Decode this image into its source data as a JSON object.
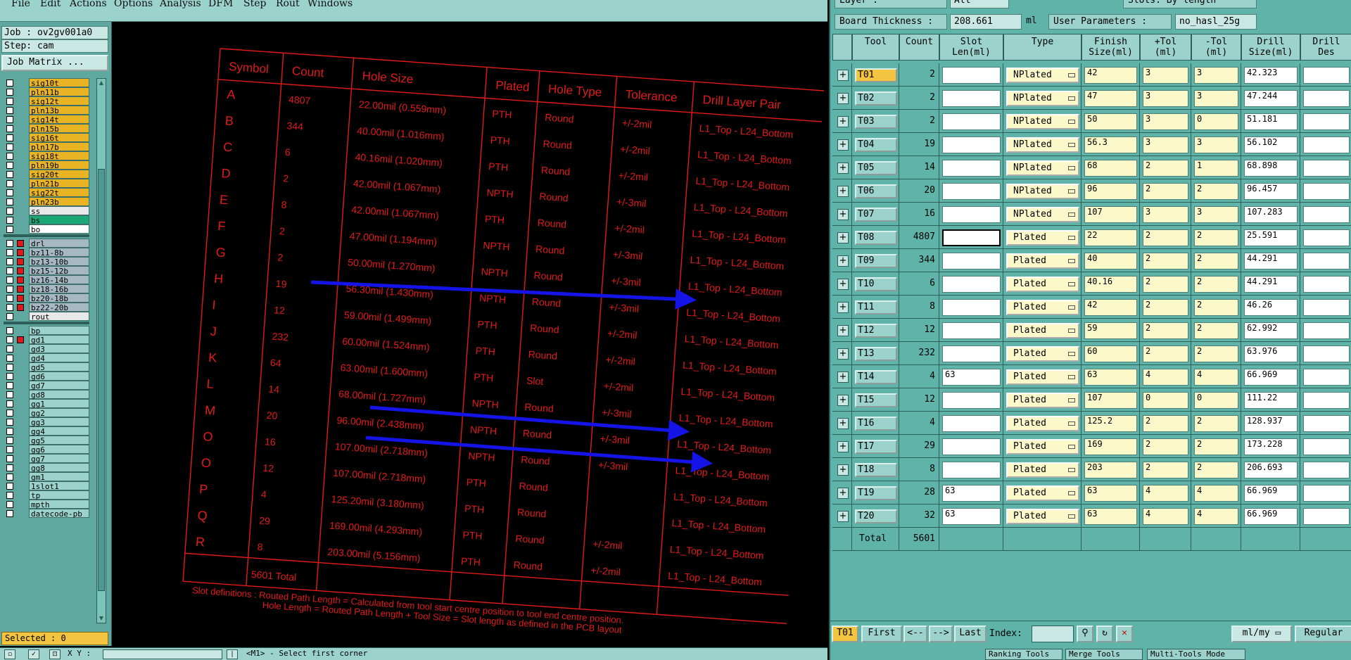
{
  "menu": [
    "File",
    "Edit",
    "Actions",
    "Options",
    "Analysis",
    "DFM",
    "Step",
    "Rout",
    "Windows"
  ],
  "job": {
    "job_label": "Job : ov2gv001a0",
    "step_label": "Step: cam",
    "matrix_button": "Job Matrix ...",
    "selected_label": "Selected : 0"
  },
  "layers_group1": [
    {
      "name": "sig10t",
      "color": "#e8b424",
      "mark": "↗"
    },
    {
      "name": "pln11b",
      "color": "#e8b424",
      "mark": ""
    },
    {
      "name": "sig12t",
      "color": "#e8b424",
      "mark": "↗"
    },
    {
      "name": "pln13b",
      "color": "#e8b424",
      "mark": ""
    },
    {
      "name": "sig14t",
      "color": "#e8b424",
      "mark": "↗"
    },
    {
      "name": "pln15b",
      "color": "#e8b424",
      "mark": ""
    },
    {
      "name": "sig16t",
      "color": "#e8b424",
      "mark": "↗"
    },
    {
      "name": "pln17b",
      "color": "#e8b424",
      "mark": ""
    },
    {
      "name": "sig18t",
      "color": "#e8b424",
      "mark": "↗"
    },
    {
      "name": "pln19b",
      "color": "#e8b424",
      "mark": ""
    },
    {
      "name": "sig20t",
      "color": "#e8b424",
      "mark": "↗"
    },
    {
      "name": "pln21b",
      "color": "#e8b424",
      "mark": ""
    },
    {
      "name": "sig22t",
      "color": "#e8b424",
      "mark": "↗"
    },
    {
      "name": "pln23b",
      "color": "#e8b424",
      "mark": ""
    },
    {
      "name": "ss",
      "color": "#e8e8e8",
      "mark": ""
    },
    {
      "name": "bs",
      "color": "#1aa877",
      "mark": ""
    },
    {
      "name": "bo",
      "color": "#ffffff",
      "mark": ""
    }
  ],
  "layers_group2": [
    {
      "name": "drl",
      "color": "#a6b9c3",
      "red": true
    },
    {
      "name": "bz11-8b",
      "color": "#a6b9c3",
      "red": true
    },
    {
      "name": "bz13-10b",
      "color": "#a6b9c3",
      "red": true
    },
    {
      "name": "bz15-12b",
      "color": "#a6b9c3",
      "red": true
    },
    {
      "name": "bz16-14b",
      "color": "#a6b9c3",
      "red": true
    },
    {
      "name": "bz18-16b",
      "color": "#a6b9c3",
      "red": true
    },
    {
      "name": "bz20-18b",
      "color": "#a6b9c3",
      "red": true
    },
    {
      "name": "bz22-20b",
      "color": "#a6b9c3",
      "red": true
    },
    {
      "name": "rout",
      "color": "#e8e8e8",
      "red": false
    }
  ],
  "layers_group3": [
    {
      "name": "bp",
      "color": "#9bd3cc",
      "mark": ""
    },
    {
      "name": "gd1",
      "color": "#9bd3cc",
      "mark": "≡"
    },
    {
      "name": "gd3",
      "color": "#9bd3cc",
      "mark": ""
    },
    {
      "name": "gd4",
      "color": "#9bd3cc",
      "mark": ""
    },
    {
      "name": "gd5",
      "color": "#9bd3cc",
      "mark": ""
    },
    {
      "name": "gd6",
      "color": "#9bd3cc",
      "mark": ""
    },
    {
      "name": "gd7",
      "color": "#9bd3cc",
      "mark": ""
    },
    {
      "name": "gd8",
      "color": "#9bd3cc",
      "mark": ""
    },
    {
      "name": "gg1",
      "color": "#9bd3cc",
      "mark": ""
    },
    {
      "name": "gg2",
      "color": "#9bd3cc",
      "mark": ""
    },
    {
      "name": "gg3",
      "color": "#9bd3cc",
      "mark": ""
    },
    {
      "name": "gg4",
      "color": "#9bd3cc",
      "mark": ""
    },
    {
      "name": "gg5",
      "color": "#9bd3cc",
      "mark": ""
    },
    {
      "name": "gg6",
      "color": "#9bd3cc",
      "mark": ""
    },
    {
      "name": "gg7",
      "color": "#9bd3cc",
      "mark": ""
    },
    {
      "name": "gg8",
      "color": "#9bd3cc",
      "mark": ""
    },
    {
      "name": "gm1",
      "color": "#9bd3cc",
      "mark": ""
    },
    {
      "name": "1slot1",
      "color": "#9bd3cc",
      "mark": ""
    },
    {
      "name": "tp",
      "color": "#9bd3cc",
      "mark": ""
    },
    {
      "name": "mpth",
      "color": "#9bd3cc",
      "mark": ""
    },
    {
      "name": "datecode-pb",
      "color": "#9bd3cc",
      "mark": ""
    }
  ],
  "status": {
    "xy_label": "X Y :",
    "prompt": "<M1> - Select first corner"
  },
  "drawing": {
    "headers": [
      "Symbol",
      "Count",
      "Hole Size",
      "Plated",
      "Hole Type",
      "Tolerance",
      "Drill Layer Pair"
    ],
    "rows": [
      [
        "A",
        "4807",
        "22.00mil (0.559mm)",
        "PTH",
        "Round",
        "+/-2mil",
        "L1_Top - L24_Bottom"
      ],
      [
        "B",
        "344",
        "40.00mil (1.016mm)",
        "PTH",
        "Round",
        "+/-2mil",
        "L1_Top - L24_Bottom"
      ],
      [
        "C",
        "6",
        "40.16mil (1.020mm)",
        "PTH",
        "Round",
        "+/-2mil",
        "L1_Top - L24_Bottom"
      ],
      [
        "D",
        "2",
        "42.00mil (1.067mm)",
        "NPTH",
        "Round",
        "+/-3mil",
        "L1_Top - L24_Bottom"
      ],
      [
        "E",
        "8",
        "42.00mil (1.067mm)",
        "PTH",
        "Round",
        "+/-2mil",
        "L1_Top - L24_Bottom"
      ],
      [
        "F",
        "2",
        "47.00mil (1.194mm)",
        "NPTH",
        "Round",
        "+/-3mil",
        "L1_Top - L24_Bottom"
      ],
      [
        "G",
        "2",
        "50.00mil (1.270mm)",
        "NPTH",
        "Round",
        "+/-3mil",
        "L1_Top - L24_Bottom"
      ],
      [
        "H",
        "19",
        "56.30mil (1.430mm)",
        "NPTH",
        "Round",
        "+/-3mil",
        "L1_Top - L24_Bottom"
      ],
      [
        "I",
        "12",
        "59.00mil (1.499mm)",
        "PTH",
        "Round",
        "+/-2mil",
        "L1_Top - L24_Bottom"
      ],
      [
        "J",
        "232",
        "60.00mil (1.524mm)",
        "PTH",
        "Round",
        "+/-2mil",
        "L1_Top - L24_Bottom"
      ],
      [
        "K",
        "64",
        "63.00mil (1.600mm)",
        "PTH",
        "Slot",
        "+/-2mil",
        "L1_Top - L24_Bottom"
      ],
      [
        "L",
        "14",
        "68.00mil (1.727mm)",
        "NPTH",
        "Round",
        "+/-3mil",
        "L1_Top - L24_Bottom"
      ],
      [
        "M",
        "20",
        "96.00mil (2.438mm)",
        "NPTH",
        "Round",
        "+/-3mil",
        "L1_Top - L24_Bottom"
      ],
      [
        "O",
        "16",
        "107.00mil (2.718mm)",
        "NPTH",
        "Round",
        "+/-3mil",
        "L1_Top - L24_Bottom"
      ],
      [
        "O",
        "12",
        "107.00mil (2.718mm)",
        "PTH",
        "Round",
        "",
        "L1_Top - L24_Bottom"
      ],
      [
        "P",
        "4",
        "125.20mil (3.180mm)",
        "PTH",
        "Round",
        "",
        "L1_Top - L24_Bottom"
      ],
      [
        "Q",
        "29",
        "169.00mil (4.293mm)",
        "PTH",
        "Round",
        "+/-2mil",
        "L1_Top - L24_Bottom"
      ],
      [
        "R",
        "8",
        "203.00mil (5.156mm)",
        "PTH",
        "Round",
        "+/-2mil",
        "L1_Top - L24_Bottom"
      ]
    ],
    "total": "5601 Total",
    "note1": "Slot definitions :  Routed Path Length  = Calculated from tool start centre position to tool end centre position.",
    "note2": "Hole Length   = Routed Path Length + Tool Size = Slot length as defined in the PCB layout"
  },
  "right": {
    "layer_label": "Layer         :",
    "layer_value": "All",
    "slots_label": "Slots:  By length",
    "thickness_label": "Board Thickness :",
    "thickness_value": "208.661",
    "thickness_unit": "ml",
    "user_params_label": "User Parameters :",
    "user_params_value": "no_hasl_25g",
    "headers": [
      "Tool",
      "Count",
      "Slot\nLen(ml)",
      "Type",
      "Finish\nSize(ml)",
      "+Tol\n(ml)",
      "-Tol\n(ml)",
      "Drill\nSize(ml)",
      "Drill\nDes"
    ],
    "tools": [
      {
        "tool": "T01",
        "count": "2",
        "slot": "",
        "type": "NPlated",
        "finish": "42",
        "ptol": "3",
        "ntol": "3",
        "drill": "42.323"
      },
      {
        "tool": "T02",
        "count": "2",
        "slot": "",
        "type": "NPlated",
        "finish": "47",
        "ptol": "3",
        "ntol": "3",
        "drill": "47.244"
      },
      {
        "tool": "T03",
        "count": "2",
        "slot": "",
        "type": "NPlated",
        "finish": "50",
        "ptol": "3",
        "ntol": "0",
        "drill": "51.181"
      },
      {
        "tool": "T04",
        "count": "19",
        "slot": "",
        "type": "NPlated",
        "finish": "56.3",
        "ptol": "3",
        "ntol": "3",
        "drill": "56.102"
      },
      {
        "tool": "T05",
        "count": "14",
        "slot": "",
        "type": "NPlated",
        "finish": "68",
        "ptol": "2",
        "ntol": "1",
        "drill": "68.898"
      },
      {
        "tool": "T06",
        "count": "20",
        "slot": "",
        "type": "NPlated",
        "finish": "96",
        "ptol": "2",
        "ntol": "2",
        "drill": "96.457"
      },
      {
        "tool": "T07",
        "count": "16",
        "slot": "",
        "type": "NPlated",
        "finish": "107",
        "ptol": "3",
        "ntol": "3",
        "drill": "107.283"
      },
      {
        "tool": "T08",
        "count": "4807",
        "slot": "",
        "type": "Plated",
        "finish": "22",
        "ptol": "2",
        "ntol": "2",
        "drill": "25.591"
      },
      {
        "tool": "T09",
        "count": "344",
        "slot": "",
        "type": "Plated",
        "finish": "40",
        "ptol": "2",
        "ntol": "2",
        "drill": "44.291"
      },
      {
        "tool": "T10",
        "count": "6",
        "slot": "",
        "type": "Plated",
        "finish": "40.16",
        "ptol": "2",
        "ntol": "2",
        "drill": "44.291"
      },
      {
        "tool": "T11",
        "count": "8",
        "slot": "",
        "type": "Plated",
        "finish": "42",
        "ptol": "2",
        "ntol": "2",
        "drill": "46.26"
      },
      {
        "tool": "T12",
        "count": "12",
        "slot": "",
        "type": "Plated",
        "finish": "59",
        "ptol": "2",
        "ntol": "2",
        "drill": "62.992"
      },
      {
        "tool": "T13",
        "count": "232",
        "slot": "",
        "type": "Plated",
        "finish": "60",
        "ptol": "2",
        "ntol": "2",
        "drill": "63.976"
      },
      {
        "tool": "T14",
        "count": "4",
        "slot": "63",
        "type": "Plated",
        "finish": "63",
        "ptol": "4",
        "ntol": "4",
        "drill": "66.969"
      },
      {
        "tool": "T15",
        "count": "12",
        "slot": "",
        "type": "Plated",
        "finish": "107",
        "ptol": "0",
        "ntol": "0",
        "drill": "111.22"
      },
      {
        "tool": "T16",
        "count": "4",
        "slot": "",
        "type": "Plated",
        "finish": "125.2",
        "ptol": "2",
        "ntol": "2",
        "drill": "128.937"
      },
      {
        "tool": "T17",
        "count": "29",
        "slot": "",
        "type": "Plated",
        "finish": "169",
        "ptol": "2",
        "ntol": "2",
        "drill": "173.228"
      },
      {
        "tool": "T18",
        "count": "8",
        "slot": "",
        "type": "Plated",
        "finish": "203",
        "ptol": "2",
        "ntol": "2",
        "drill": "206.693"
      },
      {
        "tool": "T19",
        "count": "28",
        "slot": "63",
        "type": "Plated",
        "finish": "63",
        "ptol": "4",
        "ntol": "4",
        "drill": "66.969"
      },
      {
        "tool": "T20",
        "count": "32",
        "slot": "63",
        "type": "Plated",
        "finish": "63",
        "ptol": "4",
        "ntol": "4",
        "drill": "66.969"
      }
    ],
    "total_label": "Total",
    "total_count": "5601",
    "nav": {
      "current_tool": "T01",
      "first": "First",
      "prev": "<--",
      "next": "-->",
      "last": "Last",
      "index_label": "Index:",
      "units": "ml/my",
      "mode": "Regular"
    },
    "footer": [
      "Ranking Tools",
      "Merge Tools",
      "Multi-Tools Mode"
    ]
  },
  "colors": {
    "drawing_red": "#e21a1a",
    "annotation_blue": "#1414e6",
    "panel_teal": "#5fb3a8",
    "field_yellow": "#fbf8c9",
    "active_orange": "#f2c440"
  }
}
